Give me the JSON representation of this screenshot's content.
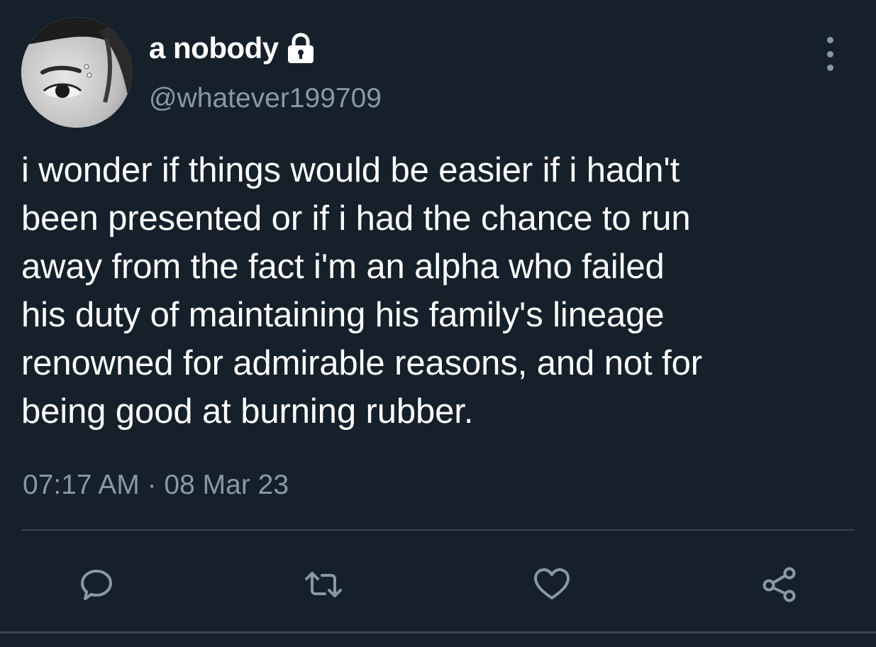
{
  "tweet": {
    "display_name": "a nobody",
    "handle": "@whatever199709",
    "text": "i wonder if things would be easier if i hadn't\nbeen presented or if i had the chance to run\naway from the fact i'm an alpha who failed\nhis duty of maintaining his family's lineage\nrenowned for admirable reasons, and not for\nbeing good at burning rubber.",
    "timestamp": "07:17 AM · 08 Mar 23"
  },
  "icons": {
    "account_badge": "lock-icon",
    "menu": "more-options-icon",
    "actions": [
      "reply-icon",
      "retweet-icon",
      "like-icon",
      "share-icon"
    ]
  },
  "colors": {
    "background": "#15202b",
    "primary_text": "#ffffff",
    "secondary_text": "#8899a6",
    "divider": "#38444d"
  }
}
